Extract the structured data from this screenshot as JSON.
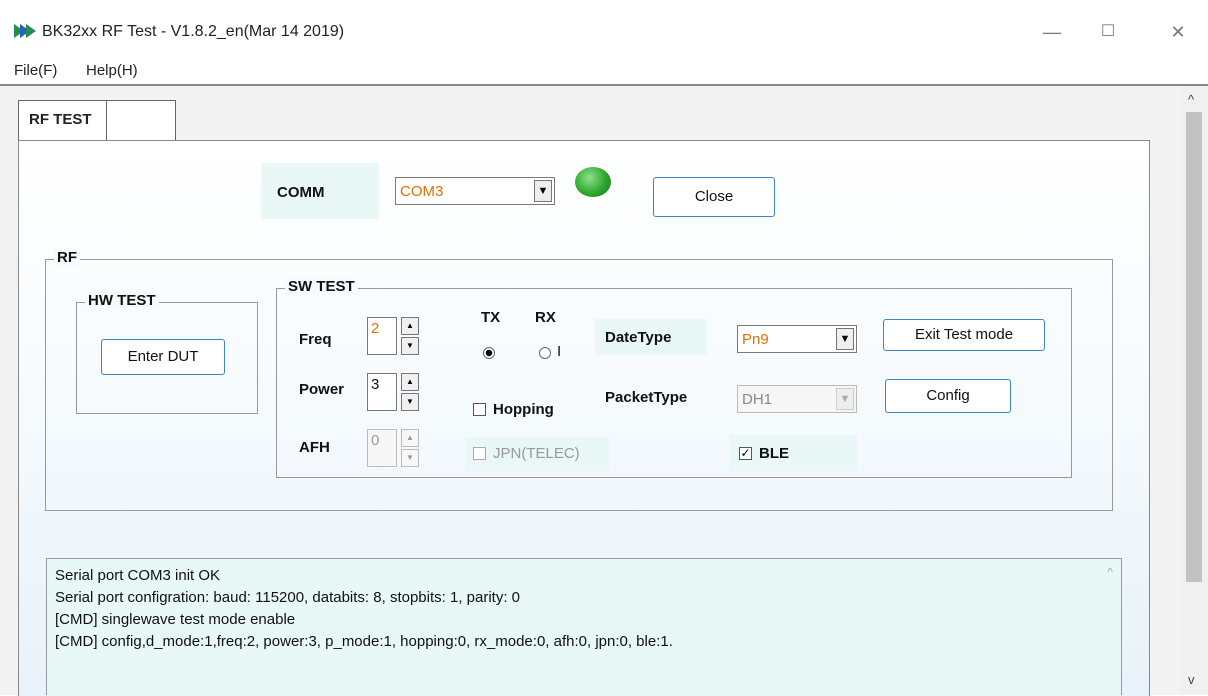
{
  "window": {
    "title": "BK32xx RF Test - V1.8.2_en(Mar 14 2019)",
    "minimize": "—",
    "maximize": "☐",
    "close": "✕",
    "icon": "app-logo-icon"
  },
  "menu": {
    "file": "File(F)",
    "help": "Help(H)"
  },
  "tabs": [
    {
      "label": "RF TEST",
      "active": true
    },
    {
      "label": ""
    }
  ],
  "comm": {
    "label": "COMM",
    "port": "COM3",
    "status_color": "#2ea82e",
    "close_button": "Close"
  },
  "rf_group": {
    "title": "RF"
  },
  "hw_test": {
    "title": "HW TEST",
    "enter_dut": "Enter DUT"
  },
  "sw_test": {
    "title": "SW TEST",
    "freq_label": "Freq",
    "freq_value": "2",
    "power_label": "Power",
    "power_value": "3",
    "afh_label": "AFH",
    "afh_value": "0",
    "tx_label": "TX",
    "rx_label": "RX",
    "rx_partial": "I",
    "mode_selected": "TX",
    "hopping_label": "Hopping",
    "hopping_checked": false,
    "jpn_label": "JPN(TELEC)",
    "jpn_checked": false,
    "datetype_label": "DateType",
    "datetype_value": "Pn9",
    "packettype_label": "PacketType",
    "packettype_value": "DH1",
    "ble_label": "BLE",
    "ble_checked": true,
    "exit_test": "Exit Test mode",
    "config": "Config"
  },
  "log": {
    "lines": [
      "Serial port COM3 init OK",
      "Serial port configration: baud: 115200, databits: 8, stopbits: 1, parity: 0",
      "[CMD] singlewave test mode enable",
      "[CMD] config,d_mode:1,freq:2, power:3, p_mode:1, hopping:0, rx_mode:0, afh:0, jpn:0, ble:1."
    ]
  },
  "icons": {
    "scroll_up": "chevron-up-icon",
    "scroll_down": "chevron-down-icon"
  }
}
